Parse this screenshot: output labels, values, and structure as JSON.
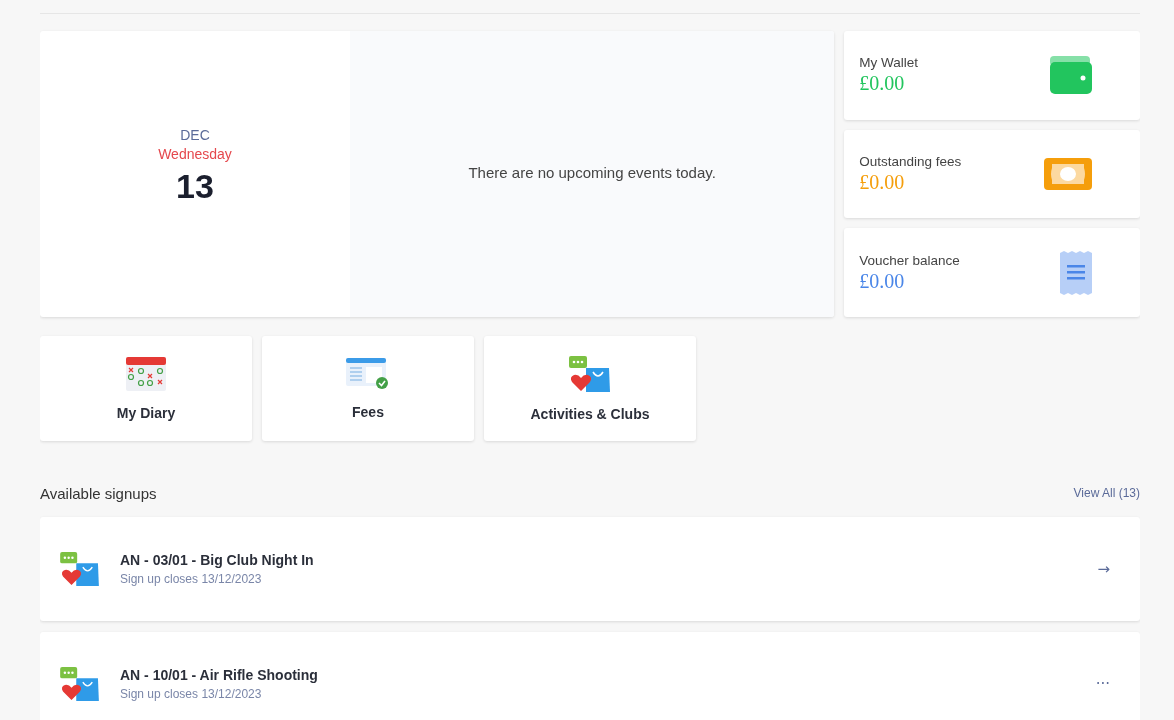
{
  "today": {
    "month": "DEC",
    "weekday": "Wednesday",
    "day": "13",
    "message": "There are no upcoming events today."
  },
  "balances": [
    {
      "label": "My Wallet",
      "amount": "£0.00",
      "kind": "wallet",
      "color": "#22c55e"
    },
    {
      "label": "Outstanding fees",
      "amount": "£0.00",
      "kind": "cash",
      "color": "#f59e0b"
    },
    {
      "label": "Voucher balance",
      "amount": "£0.00",
      "kind": "voucher",
      "color": "#4a86e8"
    }
  ],
  "shortcuts": [
    {
      "label": "My Diary",
      "kind": "calendar"
    },
    {
      "label": "Fees",
      "kind": "bill"
    },
    {
      "label": "Activities & Clubs",
      "kind": "clubs"
    }
  ],
  "signups": {
    "title": "Available signups",
    "view_all": "View All (13)",
    "items": [
      {
        "title": "AN - 03/01 - Big Club Night In",
        "subtitle": "Sign up closes 13/12/2023",
        "action": "→"
      },
      {
        "title": "AN - 10/01 - Air Rifle Shooting",
        "subtitle": "Sign up closes 13/12/2023",
        "action": "···"
      }
    ]
  }
}
